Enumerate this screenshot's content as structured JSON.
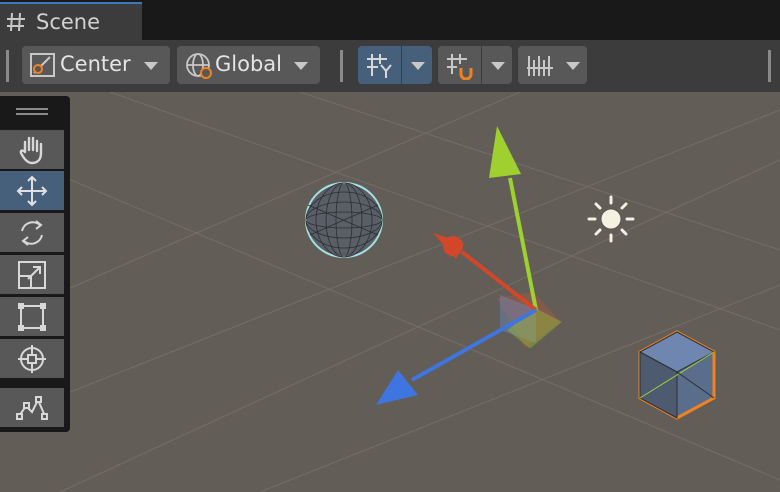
{
  "tab": {
    "title": "Scene",
    "icon": "hash-icon"
  },
  "toolbar": {
    "pivot_label": "Center",
    "space_label": "Global",
    "buttons": [
      {
        "name": "pivot-mode-dropdown",
        "icon": "pivot-icon"
      },
      {
        "name": "pivot-rotation-dropdown",
        "icon": "globe-icon"
      },
      {
        "name": "grid-visibility-button",
        "icon": "grid-y-icon",
        "active": true
      },
      {
        "name": "snap-increment-button",
        "icon": "grid-snap-icon"
      },
      {
        "name": "ruler-button",
        "icon": "ruler-icon"
      }
    ]
  },
  "tools": [
    {
      "name": "hand-tool",
      "icon": "hand-icon"
    },
    {
      "name": "move-tool",
      "icon": "move-arrows-icon",
      "active": true
    },
    {
      "name": "rotate-tool",
      "icon": "rotate-icon"
    },
    {
      "name": "scale-tool",
      "icon": "scale-icon"
    },
    {
      "name": "rect-tool",
      "icon": "rect-icon"
    },
    {
      "name": "transform-tool",
      "icon": "transform-icon"
    },
    {
      "name": "custom-tool",
      "icon": "custom-tool-icon"
    }
  ],
  "scene_objects": [
    {
      "name": "sphere",
      "type": "mesh"
    },
    {
      "name": "cube",
      "type": "mesh",
      "selected": true
    },
    {
      "name": "directional-light",
      "type": "light"
    },
    {
      "name": "move-gizmo",
      "type": "gizmo"
    }
  ],
  "colors": {
    "active_button": "#46607c",
    "axis_x": "#d2472a",
    "axis_y": "#9ed12f",
    "axis_z": "#3f75e0",
    "selection_outline": "#f2821f"
  }
}
